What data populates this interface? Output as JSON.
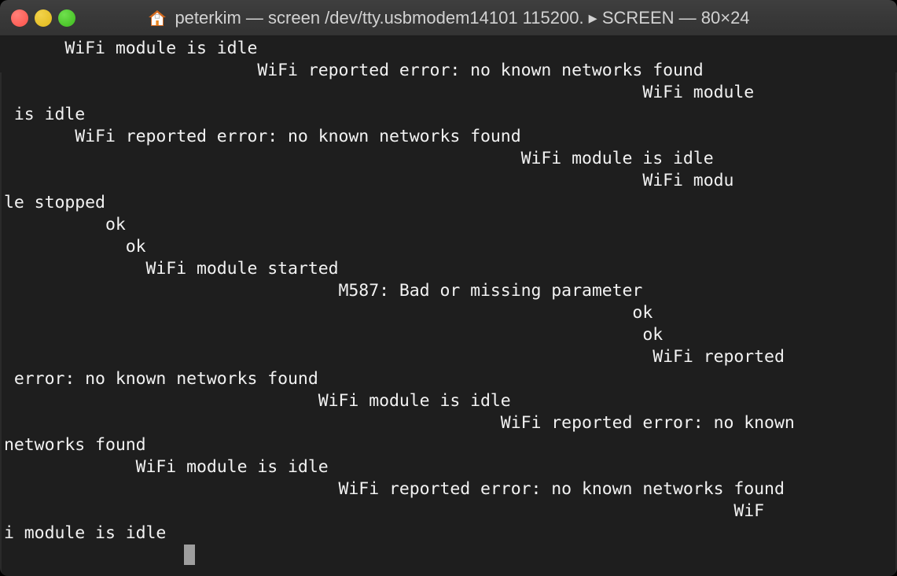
{
  "window": {
    "title": "peterkim — screen /dev/tty.usbmodem14101 115200. ▸ SCREEN — 80×24",
    "home_icon": "home-icon",
    "controls": {
      "close_label": "",
      "minimize_label": "",
      "maximize_label": ""
    },
    "colors": {
      "titlebar_bg": "#383838",
      "title_text": "#d2d2d2",
      "close": "#ff5f57",
      "minimize": "#e6c029",
      "maximize": "#4cc52b",
      "terminal_bg": "#1e1e1e",
      "terminal_fg": "#f2f2f2",
      "cursor": "#9e9e9e",
      "home_roof": "#d2691e",
      "home_body": "#ffffff"
    }
  },
  "terminal": {
    "cols": 80,
    "rows": 24,
    "cursor": {
      "row": 23,
      "col": 16
    },
    "lines": [
      "      WiFi module is idle",
      "                         WiFi reported error: no known networks found",
      "                                                               WiFi module",
      " is idle",
      "       WiFi reported error: no known networks found",
      "                                                   WiFi module is idle",
      "                                                               WiFi modu",
      "le stopped",
      "          ok",
      "            ok",
      "              WiFi module started",
      "                                 M587: Bad or missing parameter",
      "                                                              ok",
      "                                                               ok",
      "                                                                WiFi reported",
      " error: no known networks found",
      "                               WiFi module is idle",
      "                                                 WiFi reported error: no known",
      "networks found",
      "             WiFi module is idle",
      "                                 WiFi reported error: no known networks found",
      "                                                                        WiF",
      "i module is idle",
      ""
    ]
  }
}
